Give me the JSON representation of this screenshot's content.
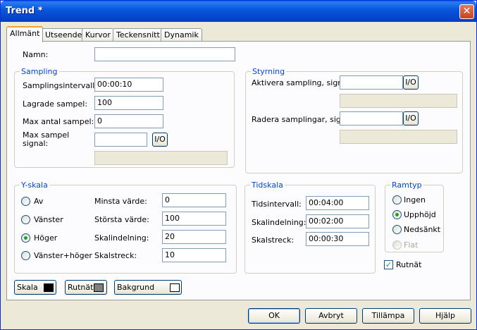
{
  "window": {
    "title": "Trend *",
    "close_label": "✕"
  },
  "tabs": [
    {
      "label": "Allmänt"
    },
    {
      "label": "Utseende"
    },
    {
      "label": "Kurvor"
    },
    {
      "label": "Teckensnitt"
    },
    {
      "label": "Dynamik"
    }
  ],
  "name": {
    "label": "Namn:",
    "value": ""
  },
  "sampling": {
    "title": "Sampling",
    "interval_label": "Samplingsintervall:",
    "interval_value": "00:00:10",
    "stored_label": "Lagrade sampel:",
    "stored_value": "100",
    "max_label": "Max antal sampel:",
    "max_value": "0",
    "max_signal_label_1": "Max sampel",
    "max_signal_label_2": "signal:",
    "max_signal_value": "",
    "io_label": "I/O"
  },
  "control": {
    "title": "Styrning",
    "activate_label": "Aktivera sampling, signal:",
    "activate_value": "",
    "clear_label": "Radera samplingar, signal:",
    "clear_value": "",
    "io_label": "I/O"
  },
  "yscale": {
    "title": "Y-skala",
    "options": [
      "Av",
      "Vänster",
      "Höger",
      "Vänster+höger"
    ],
    "selected": "Höger",
    "min_label": "Minsta värde:",
    "min_value": "0",
    "max_label": "Största värde:",
    "max_value": "100",
    "division_label": "Skalindelning:",
    "division_value": "20",
    "ticks_label": "Skalstreck:",
    "ticks_value": "10"
  },
  "timescale": {
    "title": "Tidskala",
    "interval_label": "Tidsintervall:",
    "interval_value": "00:04:00",
    "division_label": "Skalindelning:",
    "division_value": "00:02:00",
    "ticks_label": "Skalstreck:",
    "ticks_value": "00:00:30"
  },
  "frametype": {
    "title": "Ramtyp",
    "options": [
      "Ingen",
      "Upphöjd",
      "Nedsänkt",
      "Flat"
    ],
    "selected": "Upphöjd",
    "disabled": "Flat"
  },
  "grid": {
    "label": "Rutnät",
    "checked": true,
    "check_glyph": "✓"
  },
  "colors": {
    "scale": {
      "label": "Skala",
      "color": "#000000"
    },
    "grid": {
      "label": "Rutnät",
      "color": "#808080"
    },
    "background": {
      "label": "Bakgrund",
      "color": "#ffffff"
    }
  },
  "buttons": {
    "ok": "OK",
    "cancel": "Avbryt",
    "apply": "Tillämpa",
    "help": "Hjälp"
  }
}
